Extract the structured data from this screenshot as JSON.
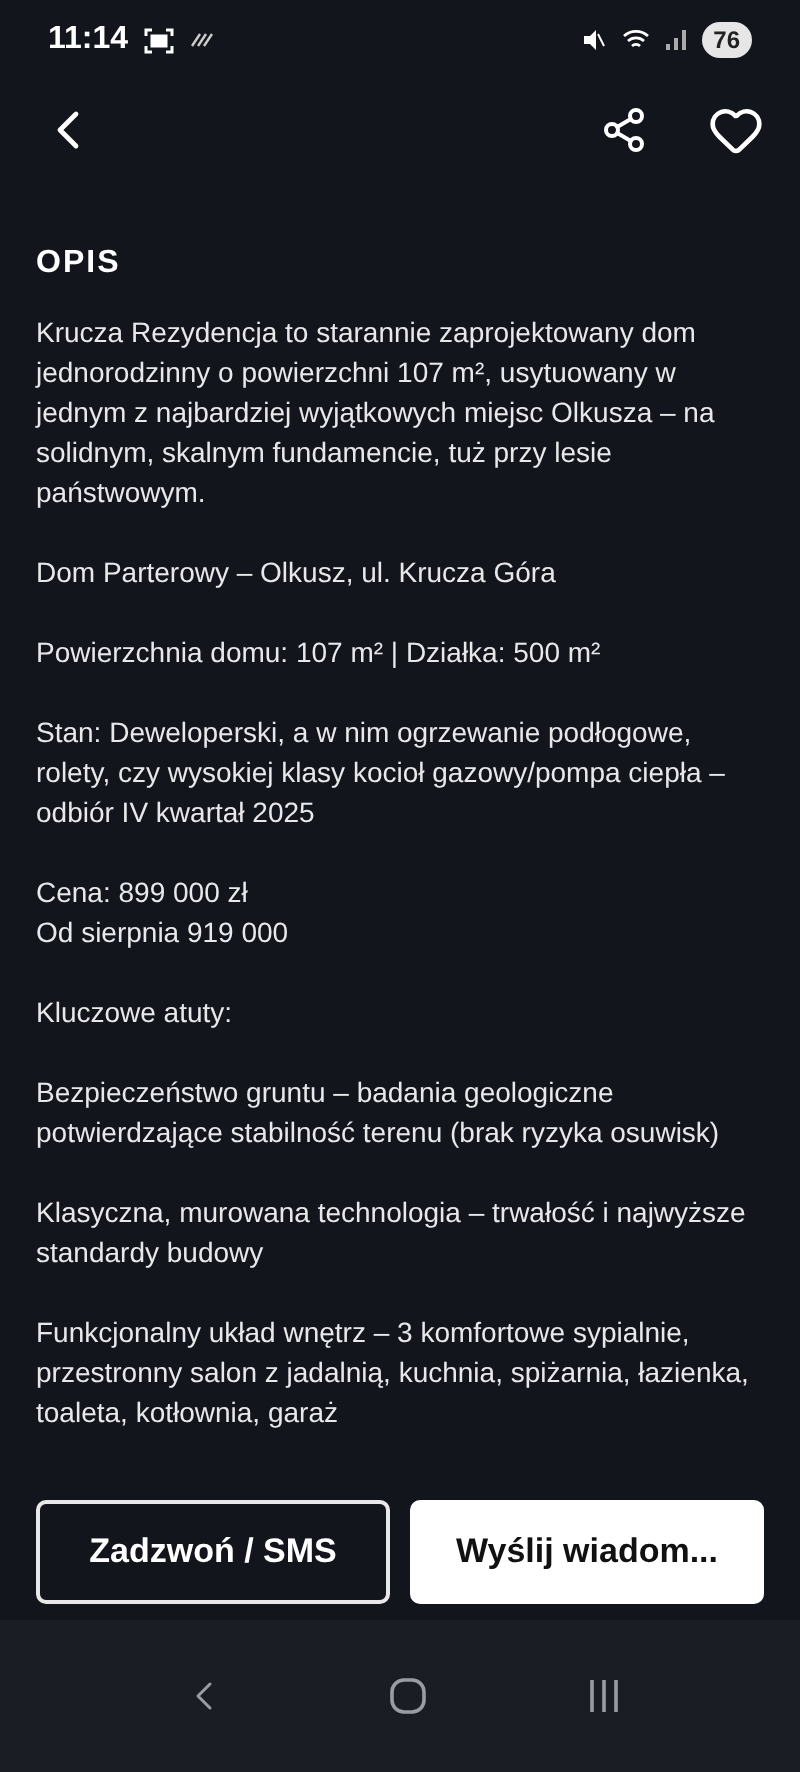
{
  "status_bar": {
    "time": "11:14",
    "battery": "76"
  },
  "section_title": "OPIS",
  "paragraphs": [
    "Krucza Rezydencja to starannie zaprojektowany dom jednorodzinny o powierzchni 107 m², usytuowany w jednym z najbardziej wyjątkowych miejsc Olkusza – na solidnym, skalnym fundamencie, tuż przy lesie państwowym.",
    "Dom Parterowy – Olkusz, ul. Krucza Góra",
    "Powierzchnia domu: 107 m² | Działka: 500 m²",
    "Stan: Deweloperski, a w nim ogrzewanie podłogowe, rolety, czy wysokiej klasy kocioł gazowy/pompa ciepła – odbiór IV kwartał 2025",
    "Cena: 899 000 zł\nOd sierpnia 919 000",
    "Kluczowe atuty:",
    "Bezpieczeństwo gruntu – badania geologiczne potwierdzające stabilność terenu (brak ryzyka osuwisk)",
    "Klasyczna, murowana technologia – trwałość i najwyższe standardy budowy",
    "Funkcjonalny układ wnętrz – 3 komfortowe sypialnie, przestronny salon z jadalnią, kuchnia, spiżarnia, łazienka, toaleta, kotłownia, garaż"
  ],
  "actions": [
    {
      "label": "Zadzwoń / SMS",
      "kind": "outline"
    },
    {
      "label": "Wyślij wiadom...",
      "kind": "filled"
    }
  ]
}
